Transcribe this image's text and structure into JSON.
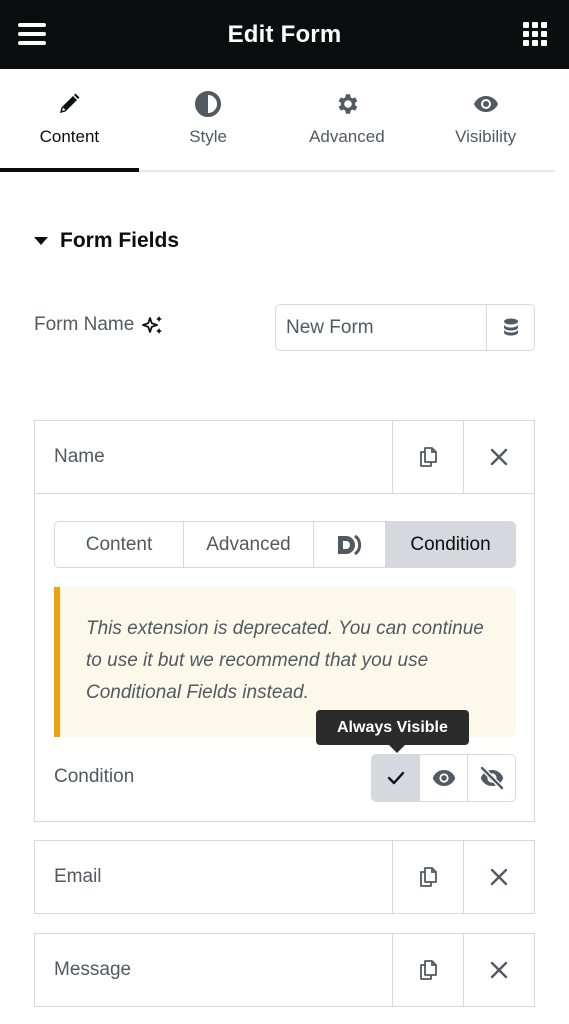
{
  "header": {
    "title": "Edit Form",
    "menu_icon": "hamburger-icon",
    "apps_icon": "grid-icon"
  },
  "tabs": [
    {
      "label": "Content",
      "icon": "pencil-icon",
      "active": true
    },
    {
      "label": "Style",
      "icon": "half-circle-icon",
      "active": false
    },
    {
      "label": "Advanced",
      "icon": "gear-icon",
      "active": false
    },
    {
      "label": "Visibility",
      "icon": "eye-icon",
      "active": false
    }
  ],
  "section": {
    "title": "Form Fields",
    "expanded": true
  },
  "form_name": {
    "label": "Form Name",
    "ai_icon": "sparkle-icon",
    "value": "New Form",
    "dynamic_icon": "database-icon"
  },
  "fields": [
    {
      "title": "Name",
      "expanded": true,
      "inner_tabs": [
        {
          "label": "Content",
          "active": false
        },
        {
          "label": "Advanced",
          "active": false
        },
        {
          "label": "",
          "icon": "dynamic-d-icon",
          "active": false
        },
        {
          "label": "Condition",
          "active": true
        }
      ],
      "notice": "This extension is deprecated. You can continue to use it but we recommend that you use Conditional Fields instead.",
      "condition": {
        "label": "Condition",
        "options": [
          {
            "name": "always-visible",
            "icon": "check-icon",
            "active": true
          },
          {
            "name": "show",
            "icon": "eye-icon",
            "active": false
          },
          {
            "name": "hide",
            "icon": "eye-slash-icon",
            "active": false
          }
        ],
        "tooltip": "Always Visible"
      }
    },
    {
      "title": "Email",
      "expanded": false
    },
    {
      "title": "Message",
      "expanded": false
    }
  ],
  "item_tools": {
    "duplicate_icon": "copy-icon",
    "remove_icon": "close-icon"
  },
  "colors": {
    "header_bg": "#0c0d0e",
    "text": "#515962",
    "border": "#d5d8dc",
    "active_bg": "#d5d8dc",
    "notice_bg": "#fcf9ea",
    "notice_accent": "#f0a10e",
    "tooltip_bg": "#2b2b2b"
  }
}
